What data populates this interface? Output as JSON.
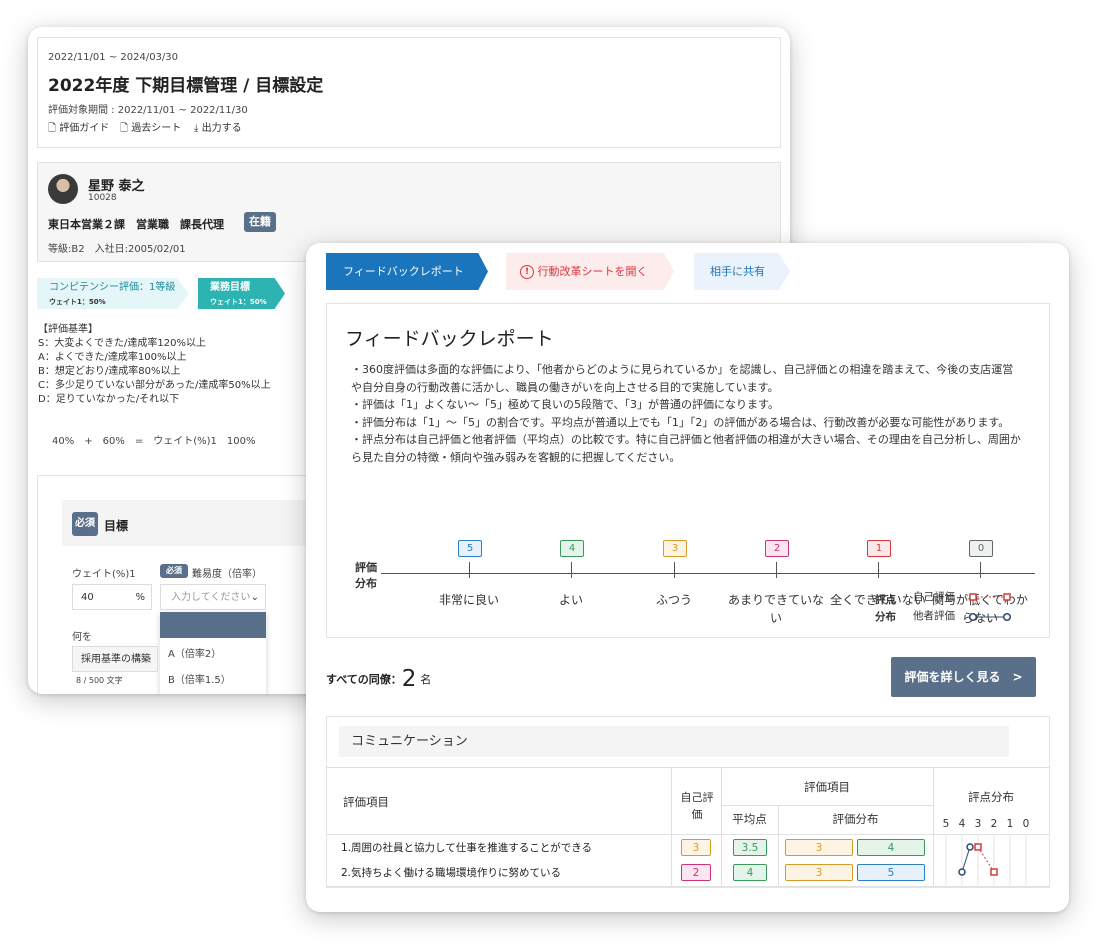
{
  "colors": {
    "accent": "#1a75bc",
    "slate": "#5a6f89",
    "teal": "#2eb3b3",
    "pink_bg": "#fdecec",
    "pink_text": "#d9363e"
  },
  "back": {
    "date_range": "2022/11/01 ~ 2024/03/30",
    "title": "2022年度 下期目標管理 / 目標設定",
    "period": "評価対象期間 : 2022/11/01 ~ 2022/11/30",
    "links": [
      "評価ガイド",
      "過去シート",
      "出力する"
    ],
    "user": {
      "name": "星野 泰之",
      "id": "10028",
      "org": "東日本営業２課　営業職　課長代理",
      "status": "在籍",
      "grade": "等級:B2　入社日:2005/02/01"
    },
    "tabs": [
      {
        "title": "コンピテンシー評価：1等級",
        "sub": "ウェイト1：50%"
      },
      {
        "title": "業務目標",
        "sub": "ウェイト1：50%"
      }
    ],
    "criteria": [
      "【評価基準】",
      "S：大変よくできた/達成率120%以上",
      "A：よくできた/達成率100%以上",
      "B：想定どおり/達成率80%以上",
      "C：多少足りていない部分があった/達成率50%以上",
      "D：足りていなかった/それ以下"
    ],
    "formula": "40%　+　60%　=　ウェイト(%)1　100%",
    "required": "必須",
    "goal_label": "目標",
    "weight_label": "ウェイト(%)1",
    "weight_value": "40",
    "weight_unit": "%",
    "difficulty_label": "難易度（倍率）",
    "difficulty_placeholder": "入力してください",
    "difficulty_options": [
      "A（倍率2）",
      "B（倍率1.5）"
    ],
    "what_label": "何を",
    "what_value": "採用基準の構築",
    "char_count": "8 / 500 文字"
  },
  "front": {
    "tabs": [
      "フィードバックレポート",
      "行動改革シートを開く",
      "相手に共有"
    ],
    "title": "フィードバックレポート",
    "paragraphs": [
      "・360度評価は多面的な評価により、「他者からどのように見られているか」を認識し、自己評価との相違を踏まえて、今後の支店運営",
      "や自分自身の行動改善に活かし、職員の働きがいを向上させる目的で実施しています。",
      "・評価は「1」よくない〜「5」極めて良いの5段階で、「3」が普通の評価になります。",
      "・評価分布は「1」〜「5」の割合です。平均点が普通以上でも「1」「2」の評価がある場合は、行動改善が必要な可能性があります。",
      "・評点分布は自己評価と他者評価（平均点）の比較です。特に自己評価と他者評価の相違が大きい場合、その理由を自己分析し、周囲か",
      "ら見た自分の特徴・傾向や強み弱みを客観的に把握してください。"
    ],
    "dist_label": [
      "評価",
      "分布"
    ],
    "levels": [
      {
        "num": "5",
        "label": "非常に良い",
        "color": "#2f7fc1",
        "bg": "#e6f1fb"
      },
      {
        "num": "4",
        "label": "よい",
        "color": "#3a9a5c",
        "bg": "#e4f4ea"
      },
      {
        "num": "3",
        "label": "ふつう",
        "color": "#d99a2a",
        "bg": "#fdf4e3"
      },
      {
        "num": "2",
        "label": "あまりできていない",
        "color": "#c9347a",
        "bg": "#fbe6f0"
      },
      {
        "num": "1",
        "label": "全くできていない",
        "color": "#d33b3b",
        "bg": "#fce8e8"
      },
      {
        "num": "0",
        "label": "関与が低くてわからない",
        "color": "#666666",
        "bg": "#eef0f2"
      }
    ],
    "legend": {
      "title": [
        "評点",
        "分布"
      ],
      "self": "自己評価",
      "other": "他者評価"
    },
    "peers_label": "すべての同僚：",
    "peers_count": "2",
    "peers_unit": "名",
    "detail_button": "評価を詳しく見る　>",
    "section": "コミュニケーション",
    "table": {
      "h_item": "評価項目",
      "h_self": "自己評価",
      "h_eval": "評価項目",
      "h_avg": "平均点",
      "h_dist": "評価分布",
      "h_score": "評点分布",
      "scale": [
        "5",
        "4",
        "3",
        "2",
        "1",
        "0"
      ],
      "rows": [
        {
          "text": "1.周囲の社員と協力して仕事を推進することができる",
          "self": "3",
          "avg": "3.5",
          "dist": [
            "3",
            "4"
          ],
          "self_score": 3,
          "other_score": 3.5
        },
        {
          "text": "2.気持ちよく働ける職場環境作りに努めている",
          "self": "2",
          "avg": "4",
          "dist": [
            "3",
            "5"
          ],
          "self_score": 2,
          "other_score": 4
        }
      ]
    }
  }
}
